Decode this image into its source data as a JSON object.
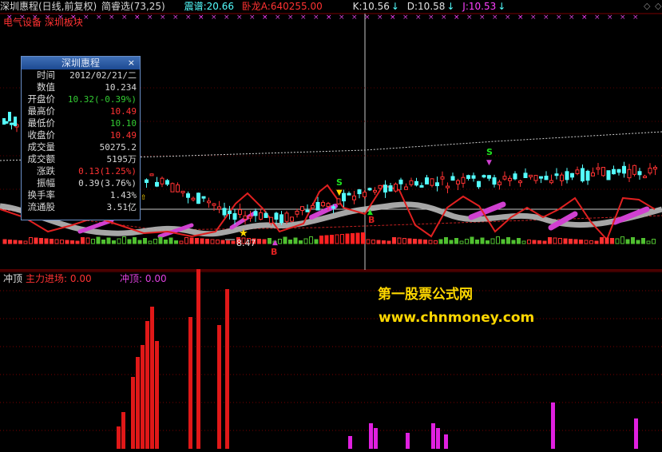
{
  "header": {
    "title": "深圳惠程(日线,前复权)",
    "formula": "简睿选(73,25)",
    "zhenpu_label": "震谱:",
    "zhenpu_value": "20.66",
    "wolong_label": "卧龙A:",
    "wolong_value": "640255.00",
    "k_label": "K:",
    "k_value": "10.56",
    "d_label": "D:",
    "d_value": "10.58",
    "j_label": "J:",
    "j_value": "10.53",
    "sector": "电气设备 深圳板块"
  },
  "info_panel": {
    "title": "深圳惠程",
    "close": "×",
    "rows": [
      {
        "label": "时间",
        "value": "2012/02/21/二",
        "color": "#d8d8d8"
      },
      {
        "label": "数值",
        "value": "10.234",
        "color": "#d8d8d8"
      },
      {
        "label": "开盘价",
        "value": "10.32(-0.39%)",
        "color": "#33cc33"
      },
      {
        "label": "最高价",
        "value": "10.49",
        "color": "#ff3333"
      },
      {
        "label": "最低价",
        "value": "10.10",
        "color": "#33cc33"
      },
      {
        "label": "收盘价",
        "value": "10.49",
        "color": "#ff3333"
      },
      {
        "label": "成交量",
        "value": "50275.2",
        "color": "#d8d8d8"
      },
      {
        "label": "成交额",
        "value": "5195万",
        "color": "#d8d8d8"
      },
      {
        "label": "涨跌",
        "value": "0.13(1.25%)",
        "color": "#ff3333"
      },
      {
        "label": "振幅",
        "value": "0.39(3.76%)",
        "color": "#d8d8d8"
      },
      {
        "label": "换手率",
        "value": "1.43%",
        "color": "#d8d8d8"
      },
      {
        "label": "流通股",
        "value": "3.51亿",
        "color": "#d8d8d8"
      }
    ]
  },
  "chart_annotations": {
    "low_price_label": "8.47",
    "signal_s": "S",
    "signal_b": "B"
  },
  "sub_chart": {
    "name": "冲顶",
    "series1_label": "主力进场:",
    "series1_value": "0.00",
    "series2_label": "冲顶:",
    "series2_value": "0.00"
  },
  "watermark": {
    "line1": "第一股票公式网",
    "line2": "www.chnmoney.com"
  },
  "colors": {
    "up": "#ff3232",
    "down": "#54ffff",
    "purple": "#d040d0",
    "accent_yellow": "#ffd800",
    "grid": "#7a0000"
  },
  "chart_data": [
    {
      "type": "line",
      "title": "深圳惠程(日线,前复权)",
      "series": [
        {
          "name": "K",
          "values": [
            10.56
          ]
        },
        {
          "name": "D",
          "values": [
            10.58
          ]
        },
        {
          "name": "J",
          "values": [
            10.53
          ]
        }
      ],
      "annotations": [
        "8.47",
        "S",
        "B"
      ]
    },
    {
      "type": "bar",
      "title": "冲顶",
      "series": [
        {
          "name": "主力进场",
          "values": [
            28,
            46,
            90,
            115,
            130,
            160,
            178,
            135,
            165,
            225,
            155,
            200
          ]
        },
        {
          "name": "冲顶",
          "values": [
            16,
            32,
            26,
            20,
            32,
            26,
            18,
            58,
            38,
            30
          ]
        }
      ]
    }
  ]
}
